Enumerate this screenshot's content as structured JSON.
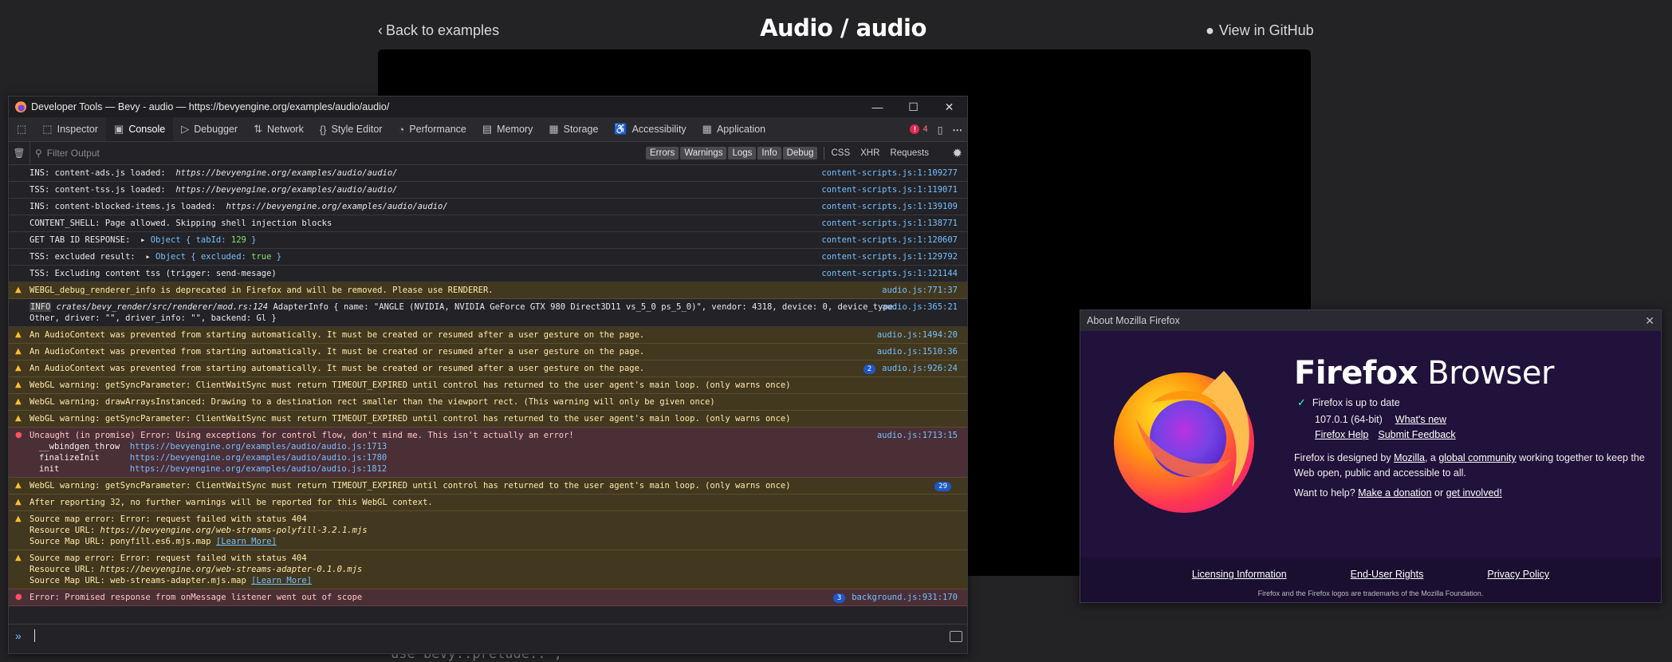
{
  "page": {
    "back_link": "Back to examples",
    "title": "Audio / audio",
    "github_link": "View in GitHub",
    "code_fragment": "use bevy::prelude::*;"
  },
  "devtools": {
    "window_title": "Developer Tools — Bevy - audio — https://bevyengine.org/examples/audio/audio/",
    "window_controls": [
      "—",
      "☐",
      "✕"
    ],
    "tabs": [
      {
        "label": "Inspector",
        "icon": "inspector-icon"
      },
      {
        "label": "Console",
        "icon": "console-icon",
        "active": true
      },
      {
        "label": "Debugger",
        "icon": "debugger-icon"
      },
      {
        "label": "Network",
        "icon": "network-icon"
      },
      {
        "label": "Style Editor",
        "icon": "style-editor-icon"
      },
      {
        "label": "Performance",
        "icon": "performance-icon"
      },
      {
        "label": "Memory",
        "icon": "memory-icon"
      },
      {
        "label": "Storage",
        "icon": "storage-icon"
      },
      {
        "label": "Accessibility",
        "icon": "accessibility-icon"
      },
      {
        "label": "Application",
        "icon": "application-icon"
      }
    ],
    "error_count": "4",
    "filter_placeholder": "Filter Output",
    "levels": [
      "Errors",
      "Warnings",
      "Logs",
      "Info",
      "Debug"
    ],
    "request_filters": [
      "CSS",
      "XHR",
      "Requests"
    ],
    "messages": [
      {
        "level": "log",
        "parts": [
          {
            "t": "INS: content-ads.js loaded:  "
          },
          {
            "t": "https://bevyengine.org/examples/audio/audio/",
            "c": "ital"
          }
        ],
        "source": "content-scripts.js:1:109277"
      },
      {
        "level": "log",
        "parts": [
          {
            "t": "TSS: content-tss.js loaded:  "
          },
          {
            "t": "https://bevyengine.org/examples/audio/audio/",
            "c": "ital"
          }
        ],
        "source": "content-scripts.js:1:119071"
      },
      {
        "level": "log",
        "parts": [
          {
            "t": "INS: content-blocked-items.js loaded:  "
          },
          {
            "t": "https://bevyengine.org/examples/audio/audio/",
            "c": "ital"
          }
        ],
        "source": "content-scripts.js:1:139109"
      },
      {
        "level": "log",
        "parts": [
          {
            "t": "CONTENT_SHELL: Page allowed. Skipping shell injection blocks"
          }
        ],
        "source": "content-scripts.js:1:138771"
      },
      {
        "level": "log",
        "parts": [
          {
            "t": "GET TAB ID RESPONSE:  ▸ "
          },
          {
            "t": "Object { tabId: ",
            "c": "obj"
          },
          {
            "t": "129",
            "c": "num"
          },
          {
            "t": " }",
            "c": "obj"
          }
        ],
        "source": "content-scripts.js:1:120607"
      },
      {
        "level": "log",
        "parts": [
          {
            "t": "TSS: excluded result:  ▸ "
          },
          {
            "t": "Object { excluded: ",
            "c": "obj"
          },
          {
            "t": "true",
            "c": "num"
          },
          {
            "t": " }",
            "c": "obj"
          }
        ],
        "source": "content-scripts.js:1:129792"
      },
      {
        "level": "log",
        "parts": [
          {
            "t": "TSS: Excluding content tss (trigger: send-mesage)"
          }
        ],
        "source": "content-scripts.js:1:121144"
      },
      {
        "level": "warn",
        "parts": [
          {
            "t": "WEBGL_debug_renderer_info is deprecated in Firefox and will be removed. Please use RENDERER."
          }
        ],
        "source": "audio.js:771:37"
      },
      {
        "level": "log",
        "parts": [
          {
            "t": "INFO",
            "c": "info-tag"
          },
          {
            "t": " crates/bevy_render/src/renderer/mod.rs:124",
            "c": "ital"
          },
          {
            "t": " AdapterInfo { name: \"ANGLE (NVIDIA, NVIDIA GeForce GTX 980 Direct3D11 vs_5_0 ps_5_0)\", vendor: 4318, device: 0, device_type:"
          }
        ],
        "sub": [
          "Other, driver: \"\", driver_info: \"\", backend: Gl }"
        ],
        "sub_indent": false,
        "source": "audio.js:365:21"
      },
      {
        "level": "warn",
        "parts": [
          {
            "t": "An AudioContext was prevented from starting automatically. It must be created or resumed after a user gesture on the page."
          }
        ],
        "source": "audio.js:1494:20"
      },
      {
        "level": "warn",
        "parts": [
          {
            "t": "An AudioContext was prevented from starting automatically. It must be created or resumed after a user gesture on the page."
          }
        ],
        "source": "audio.js:1510:36"
      },
      {
        "level": "warn",
        "parts": [
          {
            "t": "An AudioContext was prevented from starting automatically. It must be created or resumed after a user gesture on the page."
          }
        ],
        "count": "2",
        "source": "audio.js:926:24"
      },
      {
        "level": "warn",
        "parts": [
          {
            "t": "WebGL warning: getSyncParameter: ClientWaitSync must return TIMEOUT_EXPIRED until control has returned to the user agent's main loop. (only warns once)"
          }
        ],
        "source": ""
      },
      {
        "level": "warn",
        "parts": [
          {
            "t": "WebGL warning: drawArraysInstanced: Drawing to a destination rect smaller than the viewport rect. (This warning will only be given once)"
          }
        ],
        "source": ""
      },
      {
        "level": "warn",
        "parts": [
          {
            "t": "WebGL warning: getSyncParameter: ClientWaitSync must return TIMEOUT_EXPIRED until control has returned to the user agent's main loop. (only warns once)"
          }
        ],
        "source": ""
      },
      {
        "level": "error",
        "parts": [
          {
            "t": "Uncaught (in promise) Error: Using exceptions for control flow, don't mind me. This isn't actually an error!"
          }
        ],
        "stack": [
          {
            "fn": "__wbindgen_throw",
            "loc": "https://bevyengine.org/examples/audio/audio.js:1713"
          },
          {
            "fn": "finalizeInit    ",
            "loc": "https://bevyengine.org/examples/audio/audio.js:1780"
          },
          {
            "fn": "init            ",
            "loc": "https://bevyengine.org/examples/audio/audio.js:1812"
          }
        ],
        "source": "audio.js:1713:15"
      },
      {
        "level": "warn",
        "parts": [
          {
            "t": "WebGL warning: getSyncParameter: ClientWaitSync must return TIMEOUT_EXPIRED until control has returned to the user agent's main loop. (only warns once)"
          }
        ],
        "count": "29",
        "source": ""
      },
      {
        "level": "warn",
        "parts": [
          {
            "t": "After reporting 32, no further warnings will be reported for this WebGL context."
          }
        ],
        "source": ""
      },
      {
        "level": "warn",
        "parts": [
          {
            "t": "Source map error: Error: request failed with status 404"
          }
        ],
        "sublines": [
          [
            {
              "t": "Resource URL: "
            },
            {
              "t": "https://bevyengine.org/web-streams-polyfill-3.2.1.mjs",
              "c": "ital"
            }
          ],
          [
            {
              "t": "Source Map URL: ponyfill.es6.mjs.map "
            },
            {
              "t": "[Learn More]",
              "c": "ulink"
            }
          ]
        ],
        "source": ""
      },
      {
        "level": "warn",
        "parts": [
          {
            "t": "Source map error: Error: request failed with status 404"
          }
        ],
        "sublines": [
          [
            {
              "t": "Resource URL: "
            },
            {
              "t": "https://bevyengine.org/web-streams-adapter-0.1.0.mjs",
              "c": "ital"
            }
          ],
          [
            {
              "t": "Source Map URL: web-streams-adapter.mjs.map "
            },
            {
              "t": "[Learn More]",
              "c": "ulink"
            }
          ]
        ],
        "source": ""
      },
      {
        "level": "error",
        "parts": [
          {
            "t": "Error: Promised response from onMessage listener went out of scope"
          }
        ],
        "count": "3",
        "source": "background.js:931:170"
      }
    ]
  },
  "about": {
    "window_title": "About Mozilla Firefox",
    "brand_bold": "Firefox",
    "brand_light": " Browser",
    "status": "Firefox is up to date",
    "version": "107.0.1 (64-bit)",
    "whats_new": "What's new",
    "help": "Firefox Help",
    "feedback": "Submit Feedback",
    "designed_pre": "Firefox is designed by ",
    "mozilla": "Mozilla",
    "designed_mid": ", a ",
    "community": "global community",
    "designed_post": " working together to keep the Web open, public and accessible to all.",
    "want_help": "Want to help? ",
    "donation": "Make a donation",
    "or": " or ",
    "involved": "get involved!",
    "footer_links": [
      "Licensing Information",
      "End-User Rights",
      "Privacy Policy"
    ],
    "trademark": "Firefox and the Firefox logos are trademarks of the Mozilla Foundation."
  }
}
